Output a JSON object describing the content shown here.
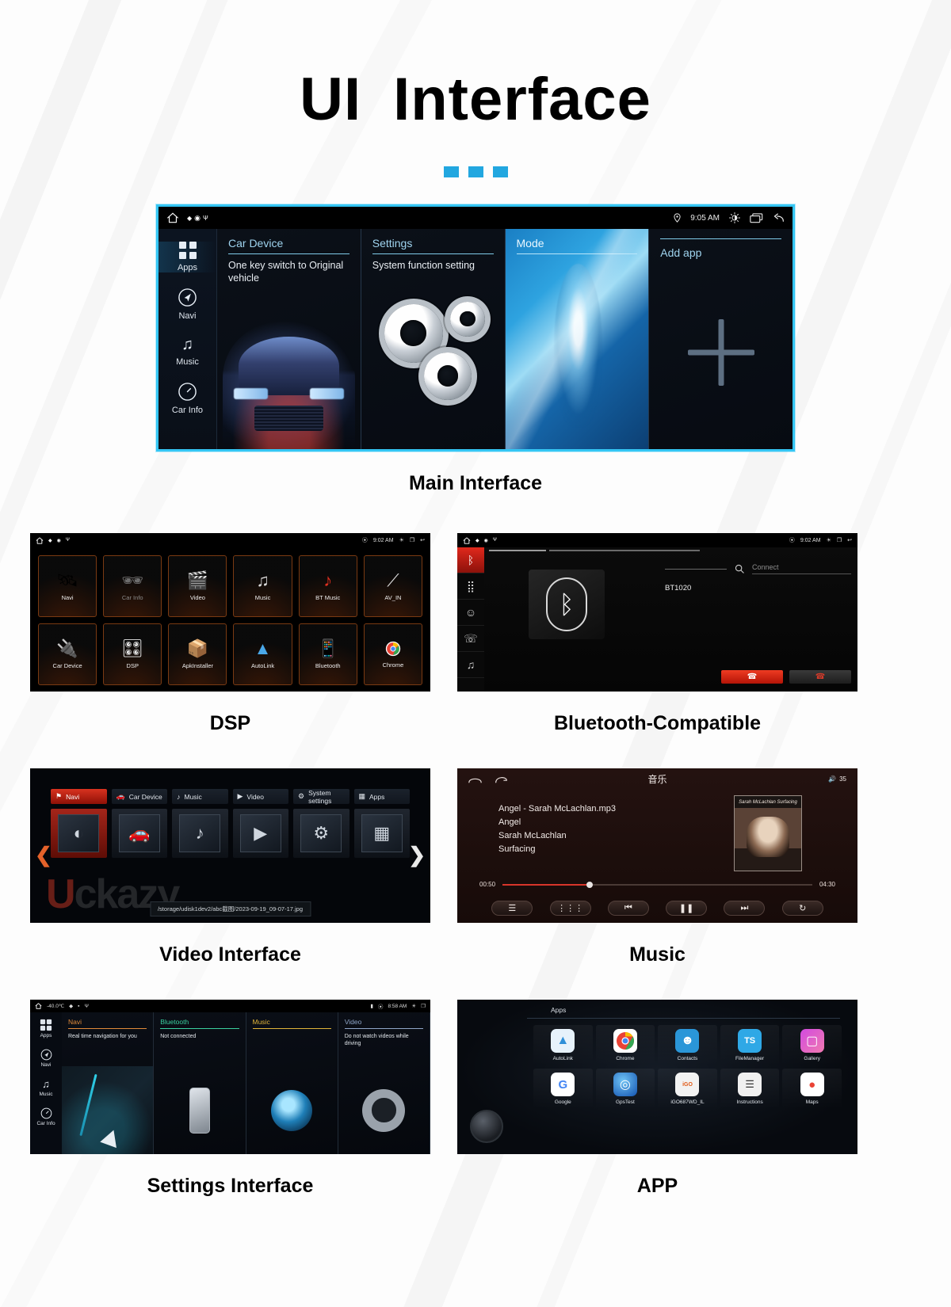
{
  "header": {
    "title_part1": "UI",
    "title_part2": "Interface",
    "dots_count": 3,
    "accent_color": "#22a7e0"
  },
  "main_interface": {
    "caption": "Main Interface",
    "status_bar": {
      "home_icon": "home-icon",
      "left_icons": [
        "bluetooth-icon",
        "gps-icon",
        "usb-icon"
      ],
      "location_icon": "location-pin-icon",
      "time": "9:05 AM",
      "brightness_icon": "brightness-icon",
      "windows_icon": "multi-window-icon",
      "back_icon": "back-arrow-icon"
    },
    "rail": [
      {
        "label": "Apps",
        "icon": "apps-grid-icon",
        "active": true
      },
      {
        "label": "Navi",
        "icon": "navigation-icon",
        "active": false
      },
      {
        "label": "Music",
        "icon": "music-note-icon",
        "active": false
      },
      {
        "label": "Car Info",
        "icon": "gauge-icon",
        "active": false
      }
    ],
    "cards": [
      {
        "title": "Car Device",
        "desc": "One key switch to Original vehicle",
        "art": "car"
      },
      {
        "title": "Settings",
        "desc": "System function setting",
        "art": "gears"
      },
      {
        "title": "Mode",
        "desc": "",
        "art": "mode"
      },
      {
        "title": "Add app",
        "desc": "",
        "art": "plus"
      }
    ]
  },
  "dsp_panel": {
    "caption": "DSP",
    "status_bar": {
      "time": "9:02 AM",
      "home_icon": "home-icon"
    },
    "apps": [
      {
        "label": "Navi",
        "icon": "satellite-icon",
        "dim": false
      },
      {
        "label": "Car Info",
        "icon": "car-info-icon",
        "dim": true
      },
      {
        "label": "Video",
        "icon": "clapperboard-icon",
        "dim": false
      },
      {
        "label": "Music",
        "icon": "music-note-icon",
        "dim": false
      },
      {
        "label": "BT Music",
        "icon": "bluetooth-music-icon",
        "dim": false
      },
      {
        "label": "AV_IN",
        "icon": "av-cable-icon",
        "dim": false
      },
      {
        "label": "Car Device",
        "icon": "usb-switch-icon",
        "dim": false
      },
      {
        "label": "DSP",
        "icon": "equalizer-icon",
        "dim": false
      },
      {
        "label": "ApkInstaller",
        "icon": "package-box-icon",
        "dim": false
      },
      {
        "label": "AutoLink",
        "icon": "autolink-icon",
        "dim": false
      },
      {
        "label": "Bluetooth",
        "icon": "bluetooth-phone-icon",
        "dim": false
      },
      {
        "label": "Chrome",
        "icon": "chrome-icon",
        "dim": false
      }
    ]
  },
  "bluetooth_panel": {
    "caption": "Bluetooth-Compatible",
    "status_bar": {
      "time": "9:02 AM",
      "home_icon": "home-icon"
    },
    "rail": [
      {
        "icon": "bluetooth-icon",
        "active": true
      },
      {
        "icon": "dialpad-icon",
        "active": false
      },
      {
        "icon": "contacts-icon",
        "active": false
      },
      {
        "icon": "call-history-icon",
        "active": false
      },
      {
        "icon": "bt-music-icon",
        "active": false
      }
    ],
    "center_logo_icon": "bluetooth-logo-icon",
    "search_icon": "search-icon",
    "connect_placeholder": "Connect",
    "device_name": "BT1020",
    "buttons": [
      {
        "name": "call-button",
        "icon": "call-icon",
        "style": "red"
      },
      {
        "name": "hangup-button",
        "icon": "hangup-icon",
        "style": "grey"
      }
    ]
  },
  "video_panel": {
    "caption": "Video Interface",
    "tabs": [
      {
        "label": "Navi",
        "icon": "navi-flag-icon",
        "active": true
      },
      {
        "label": "Car Device",
        "icon": "car-icon",
        "active": false
      },
      {
        "label": "Music",
        "icon": "music-note-icon",
        "active": false
      },
      {
        "label": "Video",
        "icon": "play-circle-icon",
        "active": false
      },
      {
        "label": "System settings",
        "icon": "gear-icon",
        "active": false
      },
      {
        "label": "Apps",
        "icon": "apps-grid-icon",
        "active": false
      }
    ],
    "thumbnails": [
      "compass-icon",
      "car-icon",
      "music-note-icon",
      "play-icon",
      "gear-icon",
      "apps-grid-icon"
    ],
    "prev_arrow": "chevron-left-icon",
    "next_arrow": "chevron-right-icon",
    "file_path": "/storage/udisk1dev2/abc截图/2023-09-19_09-07-17.jpg",
    "watermark": "Uckazy"
  },
  "music_panel": {
    "caption": "Music",
    "home_icon": "home-icon",
    "back_icon": "back-arrow-icon",
    "title": "音乐",
    "volume_icon": "volume-icon",
    "volume_level": "35",
    "track": {
      "file": "Angel - Sarah McLachlan.mp3",
      "name": "Angel",
      "artist": "Sarah McLachlan",
      "album": "Surfacing"
    },
    "cover_text": "Sarah McLachlan   Surfacing",
    "time_elapsed": "00:50",
    "time_total": "04:30",
    "progress_percent": 27,
    "controls": [
      {
        "name": "playlist-button",
        "icon": "list-icon"
      },
      {
        "name": "equalizer-button",
        "icon": "equalizer-icon"
      },
      {
        "name": "previous-button",
        "icon": "previous-icon"
      },
      {
        "name": "play-pause-button",
        "icon": "pause-icon"
      },
      {
        "name": "next-button",
        "icon": "next-icon"
      },
      {
        "name": "repeat-button",
        "icon": "repeat-icon"
      }
    ]
  },
  "settings_panel": {
    "caption": "Settings Interface",
    "status_bar": {
      "home_icon": "home-icon",
      "temperature": "-40.0℃",
      "time": "8:58 AM",
      "brightness_icon": "brightness-icon",
      "windows_icon": "multi-window-icon"
    },
    "rail": [
      {
        "label": "Apps",
        "icon": "apps-grid-icon",
        "active": true
      },
      {
        "label": "Navi",
        "icon": "navigation-icon",
        "active": false
      },
      {
        "label": "Music",
        "icon": "music-note-icon",
        "active": false
      },
      {
        "label": "Car Info",
        "icon": "gauge-icon",
        "active": false
      }
    ],
    "cards": [
      {
        "title": "Navi",
        "desc": "Real time navigation for you",
        "accent": "#e08a3a",
        "art": "map"
      },
      {
        "title": "Bluetooth",
        "desc": "Not connected",
        "accent": "#3ad0a0",
        "art": "phone"
      },
      {
        "title": "Music",
        "desc": "",
        "accent": "#e0b43a",
        "art": "disc"
      },
      {
        "title": "Video",
        "desc": "Do not watch videos while driving",
        "accent": "#8fa6c8",
        "art": "reel"
      }
    ]
  },
  "app_panel": {
    "caption": "APP",
    "header_label": "Apps",
    "knob_icon": "rotary-knob-icon",
    "apps": [
      {
        "label": "AutoLink",
        "icon": "autolink-icon",
        "color": "#e7f2fb",
        "glyph": "▲"
      },
      {
        "label": "Chrome",
        "icon": "chrome-icon",
        "color": "#ffffff",
        "glyph": "◉"
      },
      {
        "label": "Contacts",
        "icon": "contacts-icon",
        "color": "#2a96d8",
        "glyph": "👤"
      },
      {
        "label": "FileManager",
        "icon": "file-manager-icon",
        "color": "#2fa8e6",
        "glyph": "🗂"
      },
      {
        "label": "Gallery",
        "icon": "gallery-icon",
        "color": "#c850d8",
        "glyph": "🖼"
      },
      {
        "label": "Google",
        "icon": "google-icon",
        "color": "#ffffff",
        "glyph": "G"
      },
      {
        "label": "GpsTest",
        "icon": "gps-test-icon",
        "color": "#1e7ad8",
        "glyph": "◎"
      },
      {
        "label": "iGO687WD_IL",
        "icon": "igo-icon",
        "color": "#f2f2f2",
        "glyph": "iGO"
      },
      {
        "label": "Instructions",
        "icon": "instructions-icon",
        "color": "#f0f0f0",
        "glyph": "📖"
      },
      {
        "label": "Maps",
        "icon": "maps-icon",
        "color": "#ffffff",
        "glyph": "📍"
      }
    ]
  }
}
